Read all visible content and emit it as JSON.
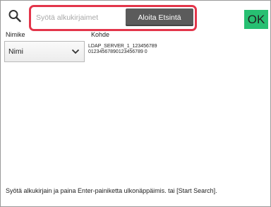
{
  "search": {
    "placeholder": "Syötä alkukirjaimet",
    "start_button_label": "Aloita Etsintä"
  },
  "ok_button_label": "OK",
  "columns": {
    "title_label": "Nimike",
    "target_label": "Kohde"
  },
  "title_select": {
    "selected": "Nimi"
  },
  "target_value": {
    "line1": "LDAP_SERVER_1_123456789",
    "line2": "01234567890123456789 0"
  },
  "status_message": "Syötä alkukirjain ja paina Enter-painiketta ulkonäppäimis. tai [Start Search].",
  "colors": {
    "highlight": "#e3354a",
    "ok_button": "#27c072",
    "start_button": "#5b5b5b"
  },
  "icons": {
    "search": "search-icon",
    "dropdown": "chevron-down-icon"
  }
}
